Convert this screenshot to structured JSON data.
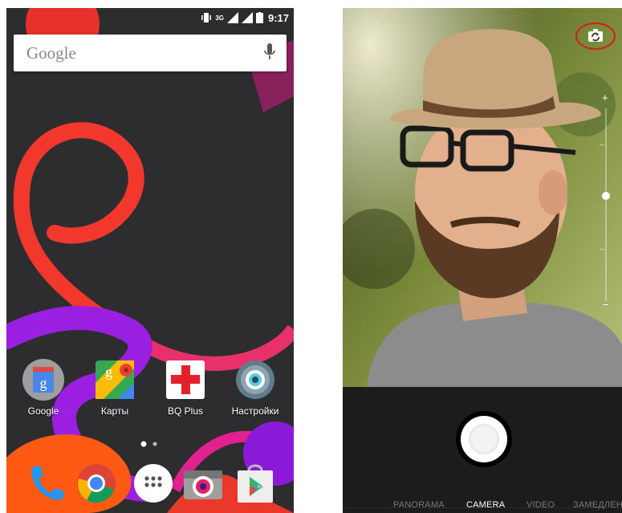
{
  "home": {
    "status_bar": {
      "time": "9:17",
      "network": "3G"
    },
    "search": {
      "logo": "Google",
      "icon": "mic-icon"
    },
    "apps": [
      {
        "label": "Google",
        "icon": "google-app-icon"
      },
      {
        "label": "Карты",
        "icon": "maps-icon"
      },
      {
        "label": "BQ Plus",
        "icon": "bq-plus-icon"
      },
      {
        "label": "Настройки",
        "icon": "settings-icon"
      }
    ],
    "dock": [
      {
        "icon": "phone-icon"
      },
      {
        "icon": "chrome-icon"
      },
      {
        "icon": "app-drawer-icon"
      },
      {
        "icon": "camera-app-icon"
      },
      {
        "icon": "play-store-icon"
      }
    ],
    "colors": {
      "accent_red": "#ff3a3a",
      "accent_purple": "#a020f0",
      "accent_orange": "#ff7a1a"
    }
  },
  "camera": {
    "switch_icon": "switch-camera-icon",
    "zoom": {
      "plus": "+",
      "minus": "−"
    },
    "modes": [
      "PANORAMA",
      "CAMERA",
      "VIDEO",
      "ЗАМЕДЛЕН"
    ],
    "active_mode": "CAMERA",
    "highlight_color": "#d21e1e"
  }
}
